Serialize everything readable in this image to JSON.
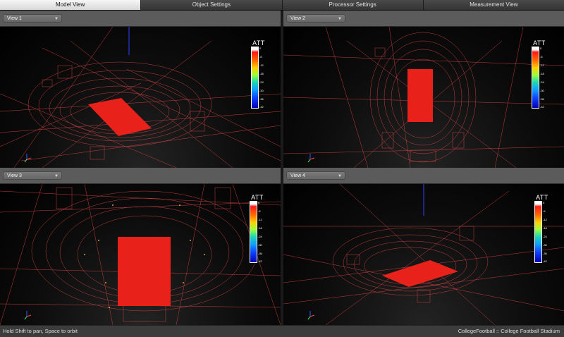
{
  "tabs": [
    {
      "label": "Model View"
    },
    {
      "label": "Object Settings"
    },
    {
      "label": "Processor Settings"
    },
    {
      "label": "Measurement View"
    }
  ],
  "views": [
    {
      "label": "View 1"
    },
    {
      "label": "View 2"
    },
    {
      "label": "View 3"
    },
    {
      "label": "View 4"
    }
  ],
  "legend": {
    "title": "ATT",
    "ticks": [
      "0",
      "-6",
      "-12",
      "-18",
      "-24",
      "-30",
      "-36",
      "-42"
    ]
  },
  "status": {
    "hint": "Hold Shift to pan, Space to orbit",
    "project": "CollegeFootball :: College Football Stadium"
  },
  "colors": {
    "wireframe": "#e04848",
    "field": "#e8221a",
    "background": "#000000"
  }
}
